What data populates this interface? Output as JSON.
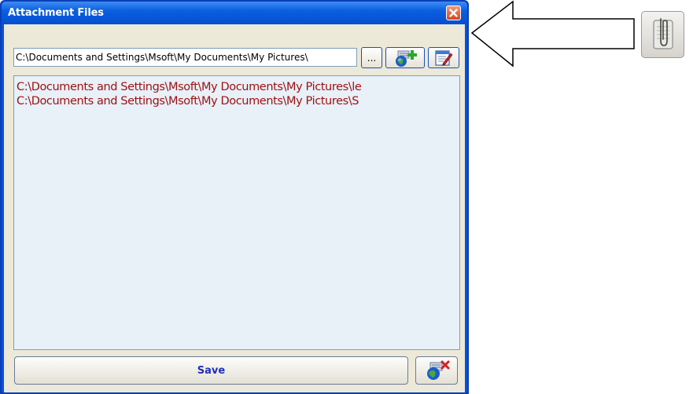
{
  "window": {
    "title": "Attachment Files"
  },
  "path_input": {
    "value": "C:\\Documents and Settings\\Msoft\\My Documents\\My Pictures\\"
  },
  "toolbar": {
    "browse_label": "...",
    "add_icon": "add-attachment-icon",
    "edit_icon": "edit-icon"
  },
  "file_list": {
    "items": [
      "C:\\Documents and Settings\\Msoft\\My Documents\\My Pictures\\le",
      "C:\\Documents and Settings\\Msoft\\My Documents\\My Pictures\\S"
    ],
    "item_color": "#9c1010"
  },
  "footer": {
    "save_label": "Save",
    "remove_icon": "remove-attachment-icon"
  },
  "external": {
    "attach_icon": "paperclip-icon"
  },
  "colors": {
    "titlebar": "#0a5fe0",
    "close": "#d8431d",
    "save_text": "#2030b8"
  }
}
